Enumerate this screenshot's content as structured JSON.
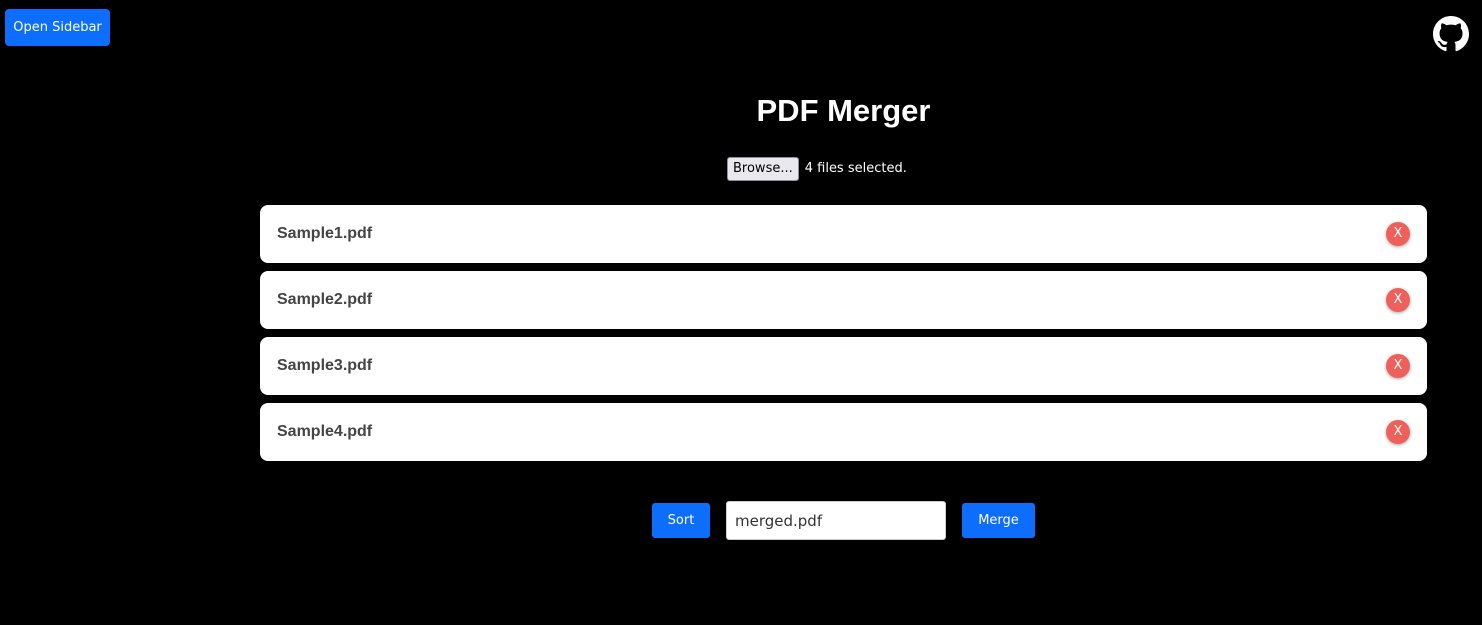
{
  "header": {
    "open_sidebar_label": "Open Sidebar",
    "github_icon": "github-icon"
  },
  "main": {
    "title": "PDF Merger",
    "file_input": {
      "browse_label": "Browse...",
      "status_text": "4 files selected."
    },
    "files": [
      {
        "name": "Sample1.pdf",
        "remove_label": "X"
      },
      {
        "name": "Sample2.pdf",
        "remove_label": "X"
      },
      {
        "name": "Sample3.pdf",
        "remove_label": "X"
      },
      {
        "name": "Sample4.pdf",
        "remove_label": "X"
      }
    ],
    "actions": {
      "sort_label": "Sort",
      "output_filename": "merged.pdf",
      "merge_label": "Merge"
    }
  },
  "colors": {
    "background": "#000000",
    "primary_button": "#0d6efd",
    "remove_button": "#f0605a",
    "file_card": "#ffffff"
  }
}
